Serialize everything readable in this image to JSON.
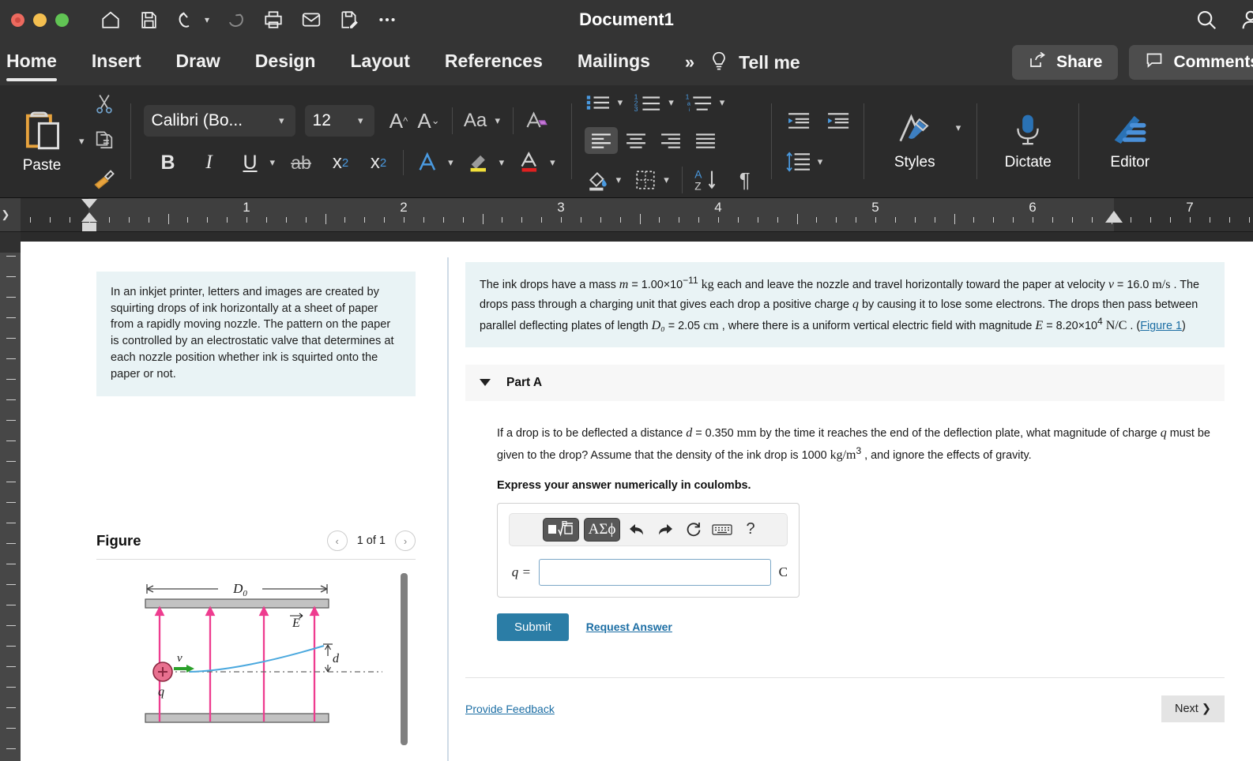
{
  "titlebar": {
    "document_title": "Document1",
    "quick_access": [
      {
        "name": "home-icon",
        "label": "Home"
      },
      {
        "name": "save-icon",
        "label": "Save"
      },
      {
        "name": "undo-icon",
        "label": "Undo"
      },
      {
        "name": "redo-icon",
        "label": "Redo"
      },
      {
        "name": "print-icon",
        "label": "Print"
      },
      {
        "name": "mail-icon",
        "label": "Email"
      },
      {
        "name": "save-as-icon",
        "label": "Save As"
      },
      {
        "name": "more-options-icon",
        "label": "More"
      }
    ],
    "right_icons": [
      {
        "name": "search-icon",
        "label": "Search"
      },
      {
        "name": "account-icon",
        "label": "Account"
      }
    ]
  },
  "ribbon_tabs": {
    "items": [
      {
        "label": "Home",
        "active": true
      },
      {
        "label": "Insert",
        "active": false
      },
      {
        "label": "Draw",
        "active": false
      },
      {
        "label": "Design",
        "active": false
      },
      {
        "label": "Layout",
        "active": false
      },
      {
        "label": "References",
        "active": false
      },
      {
        "label": "Mailings",
        "active": false
      }
    ],
    "overflow": "»",
    "tell_me": "Tell me",
    "share_label": "Share",
    "comments_label": "Comments"
  },
  "ribbon": {
    "paste_label": "Paste",
    "font_name": "Calibri (Bo...",
    "font_size": "12",
    "styles_label": "Styles",
    "dictate_label": "Dictate",
    "editor_label": "Editor",
    "icons": [
      "cut-icon",
      "copy-icon",
      "format-painter-icon",
      "grow-font-icon",
      "shrink-font-icon",
      "change-case-icon",
      "clear-formatting-icon",
      "bold-icon",
      "italic-icon",
      "underline-icon",
      "strikethrough-icon",
      "subscript-icon",
      "superscript-icon",
      "text-effects-icon",
      "highlight-icon",
      "font-color-icon",
      "bullets-icon",
      "numbering-icon",
      "multilevel-list-icon",
      "align-left-icon",
      "align-center-icon",
      "align-right-icon",
      "justify-icon",
      "decrease-indent-icon",
      "increase-indent-icon",
      "line-spacing-icon",
      "shading-icon",
      "borders-icon",
      "sort-icon",
      "show-marks-icon"
    ]
  },
  "ruler": {
    "numbers": [
      "1",
      "2",
      "3",
      "4",
      "5",
      "6",
      "7"
    ],
    "unit": "inches"
  },
  "document": {
    "left_panel": {
      "intro_text": "In an inkjet printer, letters and images are created by squirting drops of ink horizontally at a sheet of paper from a rapidly moving nozzle. The pattern on the paper is controlled by an electrostatic valve that determines at each nozzle position whether ink is squirted onto the paper or not.",
      "figure_title": "Figure",
      "figure_counter": "1 of 1",
      "figure_prev": "‹",
      "figure_next": "›",
      "diagram_labels": {
        "plate_length": "D₀",
        "field": "E",
        "velocity": "v",
        "charge": "q",
        "deflection": "d"
      }
    },
    "right_panel": {
      "problem_statement_parts": {
        "p1": "The ink drops have a mass ",
        "m": "m",
        "p2": " = 1.00×10",
        "m_exp": "−11",
        "kg": "kg",
        "p3": " each and leave the nozzle and travel horizontally toward the paper at velocity ",
        "v": "v",
        "p4": " = 16.0 ",
        "ms": "m/s",
        "p5": " . The drops pass through a charging unit that gives each drop a positive charge ",
        "q": "q",
        "p6": " by causing it to lose some electrons. The drops then pass between parallel deflecting plates of length ",
        "D0": "D₀",
        "p7": " = 2.05 ",
        "cm": "cm",
        "p8": " , where there is a uniform vertical electric field with magnitude ",
        "E": "E",
        "p9": " = 8.20×10",
        "E_exp": "4",
        "NC": "N/C",
        "p10": " . (",
        "figure_link": "Figure 1",
        "p11": ")"
      },
      "part_a": {
        "title": "Part A",
        "question_parts": {
          "q1": "If a drop is to be deflected a distance ",
          "d": "d",
          "q2": " = 0.350 ",
          "mm": "mm",
          "q3": " by the time it reaches the end of the deflection plate, what magnitude of charge ",
          "q_sym": "q",
          "q4": " must be given to the drop? Assume that the density of the ink drop is 1000 ",
          "kgm3": "kg/m",
          "kgm3_exp": "3",
          "q5": " , and ignore the effects of gravity."
        },
        "instruction": "Express your answer numerically in coulombs.",
        "answer_toolbar": [
          {
            "name": "math-template-icon",
            "label": "■√□"
          },
          {
            "name": "greek-symbols-icon",
            "label": "ΑΣϕ"
          },
          {
            "name": "undo-icon",
            "label": "←"
          },
          {
            "name": "redo-icon",
            "label": "→"
          },
          {
            "name": "reset-icon",
            "label": "↻"
          },
          {
            "name": "keyboard-icon",
            "label": "⌨"
          },
          {
            "name": "help-icon",
            "label": "?"
          }
        ],
        "answer_label": "q =",
        "answer_value": "",
        "answer_placeholder": "",
        "answer_unit": "C",
        "submit_label": "Submit",
        "request_answer_label": "Request Answer"
      },
      "provide_feedback_label": "Provide Feedback",
      "next_label": "Next",
      "next_chevron": "❯"
    }
  },
  "colors": {
    "ribbon_bg": "#2b2b2b",
    "titlebar_bg": "#343434",
    "accent_blue": "#2b7da6",
    "link_blue": "#1c6ea4",
    "highlight_box": "#e9f3f5",
    "part_header": "#f7f7f7",
    "field_pink": "#ee3c8f",
    "velocity_green": "#2aa02a",
    "charge_red": "#e05a7a",
    "trajectory_blue": "#4aa8de"
  }
}
